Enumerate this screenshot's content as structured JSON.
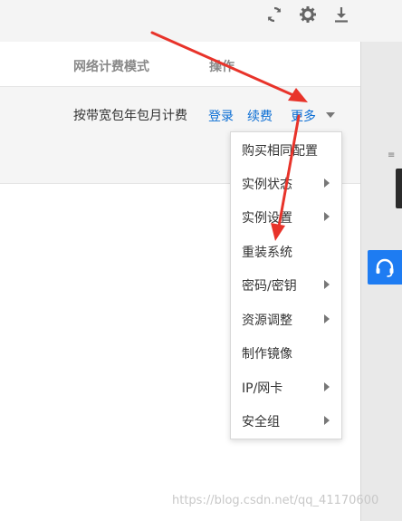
{
  "toolbar": {
    "icons": [
      "refresh-icon",
      "gear-icon",
      "download-icon"
    ]
  },
  "table": {
    "headers": {
      "billing_mode": "网络计费模式",
      "operations": "操作"
    },
    "row": {
      "billing_mode": "按带宽包年包月计费",
      "actions": {
        "login": "登录",
        "renew": "续费",
        "more": "更多"
      }
    }
  },
  "menu": {
    "items": [
      {
        "label": "购买相同配置",
        "submenu": false
      },
      {
        "label": "实例状态",
        "submenu": true
      },
      {
        "label": "实例设置",
        "submenu": true
      },
      {
        "label": "重装系统",
        "submenu": false
      },
      {
        "label": "密码/密钥",
        "submenu": true
      },
      {
        "label": "资源调整",
        "submenu": true
      },
      {
        "label": "制作镜像",
        "submenu": false
      },
      {
        "label": "IP/网卡",
        "submenu": true
      },
      {
        "label": "安全组",
        "submenu": true
      }
    ]
  },
  "colors": {
    "link": "#0a6dd4",
    "support_button": "#1e7cf2",
    "annotation_arrow": "#e8332a"
  },
  "watermark": "https://blog.csdn.net/qq_41170600"
}
